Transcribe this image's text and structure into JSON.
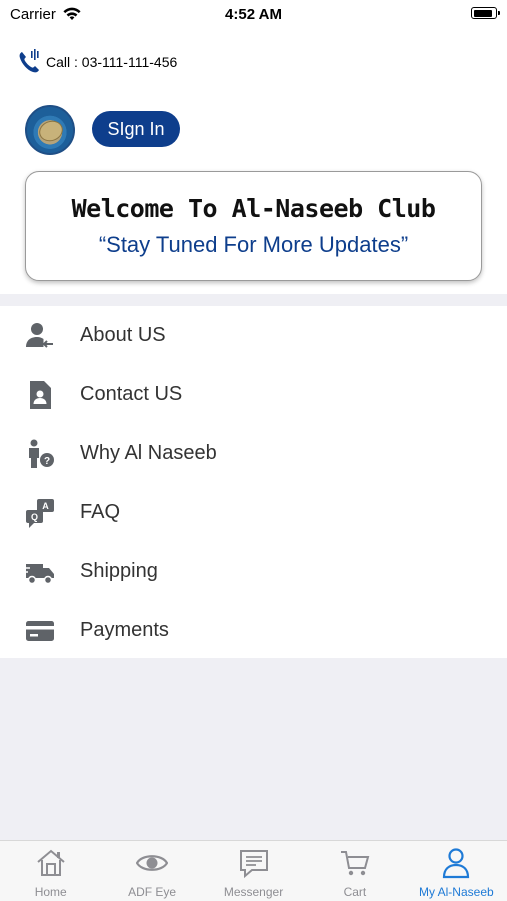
{
  "status_bar": {
    "carrier": "Carrier",
    "time": "4:52 AM",
    "battery_level": 0.9
  },
  "contact": {
    "call_text": "Call : 03-111-111-456"
  },
  "header": {
    "sign_in_label": "SIgn In"
  },
  "welcome": {
    "title": "Welcome To Al-Naseeb Club",
    "subtitle": "“Stay Tuned For More Updates”"
  },
  "menu": {
    "items": [
      {
        "label": "About US",
        "icon": "user-arrow-icon"
      },
      {
        "label": "Contact US",
        "icon": "contact-card-icon"
      },
      {
        "label": "Why Al Naseeb",
        "icon": "person-question-icon"
      },
      {
        "label": "FAQ",
        "icon": "faq-bubbles-icon"
      },
      {
        "label": "Shipping",
        "icon": "truck-icon"
      },
      {
        "label": "Payments",
        "icon": "credit-card-icon"
      }
    ]
  },
  "tab_bar": {
    "tabs": [
      {
        "label": "Home",
        "icon": "home-icon"
      },
      {
        "label": "ADF Eye",
        "icon": "eye-icon"
      },
      {
        "label": "Messenger",
        "icon": "message-icon"
      },
      {
        "label": "Cart",
        "icon": "cart-icon"
      },
      {
        "label": "My Al-Naseeb",
        "icon": "user-icon",
        "active": true
      }
    ]
  },
  "colors": {
    "brand": "#0e3e8c",
    "tab_active": "#1e7ad6",
    "tab_inactive": "#8e8e93",
    "icon_gray": "#5f6368"
  }
}
